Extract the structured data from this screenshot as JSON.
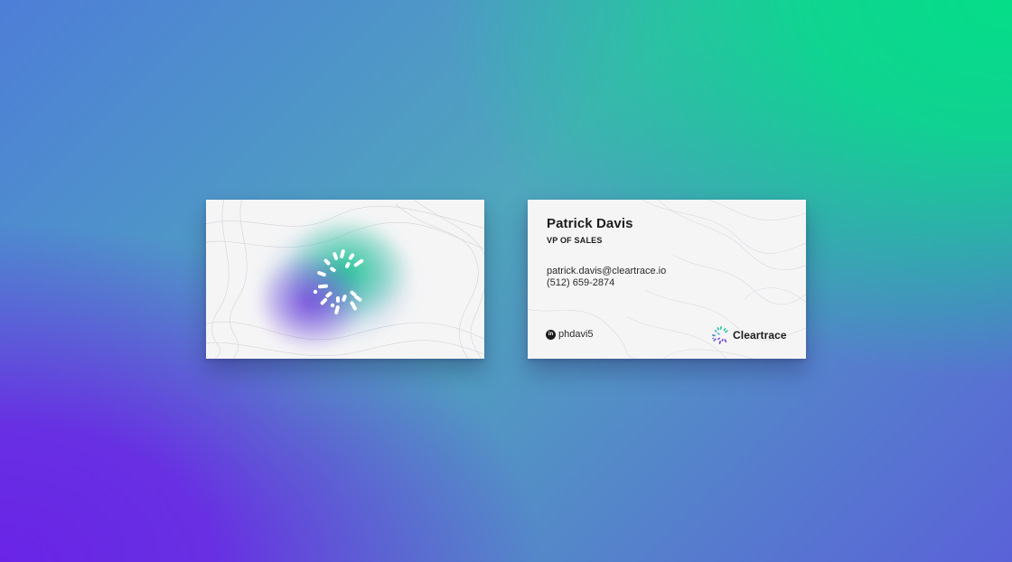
{
  "card_back": {
    "name": "Patrick Davis",
    "title": "VP OF SALES",
    "email": "patrick.davis@cleartrace.io",
    "phone": "(512) 659-2874",
    "social_icon": "linkedin-icon",
    "social_handle": "phdavi5",
    "brand_name": "Cleartrace"
  },
  "card_front": {
    "logo_icon": "cleartrace-radial-dots-logo"
  },
  "colors": {
    "background_green": "#04de88",
    "background_purple": "#6a24e6",
    "card": "#f5f5f6",
    "text": "#1c1c1c",
    "brand_teal": "#1fc7a0",
    "brand_purple": "#6a3ee0"
  }
}
